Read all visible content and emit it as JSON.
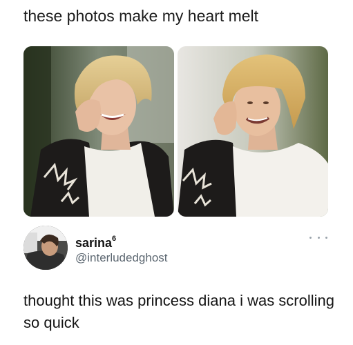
{
  "caption": "these photos make my heart melt",
  "photos": [
    {
      "name": "left-photo",
      "subject": "laughing-person-photo"
    },
    {
      "name": "right-photo",
      "subject": "smiling-person-photo"
    }
  ],
  "tweet": {
    "display_name": "sarina",
    "display_name_superscript": "6",
    "handle": "@interludedghost",
    "text": "thought this was princess diana i was scrolling so quick",
    "more_icon": "ellipsis-icon"
  },
  "colors": {
    "text": "#141414",
    "handle": "#5b6670",
    "dots": "#9aa3ab"
  }
}
